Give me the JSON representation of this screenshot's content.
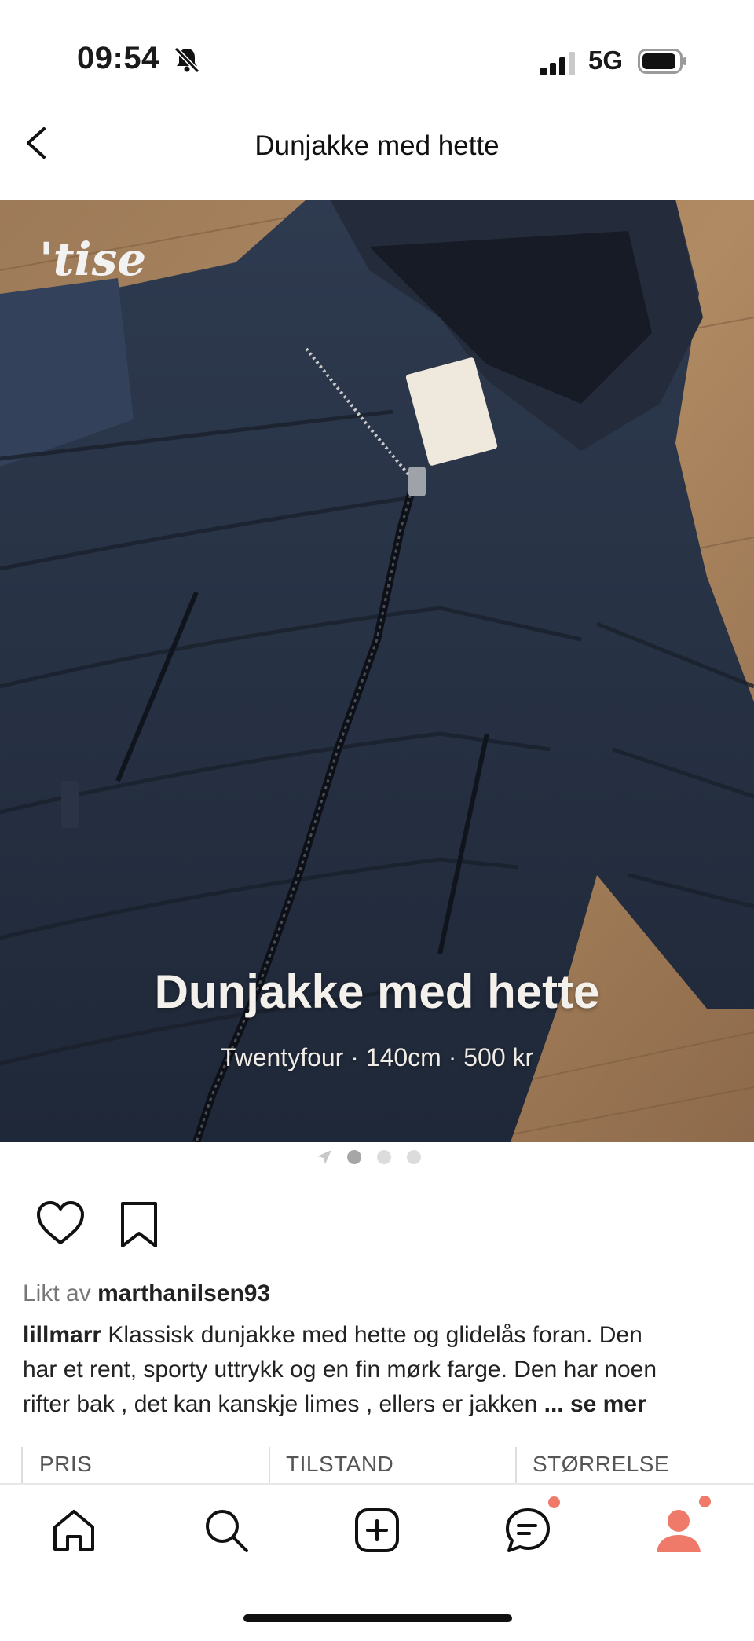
{
  "status_bar": {
    "time": "09:54",
    "network": "5G"
  },
  "header": {
    "title": "Dunjakke med hette"
  },
  "listing": {
    "overlay_title": "Dunjakke med hette",
    "overlay_subtitle": "Twentyfour · 140cm · 500 kr",
    "watermark": "'tise",
    "image_count": 3,
    "current_image": 1
  },
  "social": {
    "liked_prefix": "Likt av",
    "liked_user": "marthanilsen93",
    "seller": "lillmarr",
    "line1": "Klassisk dunjakke med hette og glidelås foran. Den",
    "line2": "har et rent, sporty uttrykk og en fin mørk farge. Den har noen",
    "line3": "rifter bak , det kan kanskje limes , ellers er jakken",
    "more": "... se mer"
  },
  "info_columns": [
    "PRIS",
    "TILSTAND",
    "STØRRELSE"
  ],
  "tabs": [
    {
      "icon": "home-icon"
    },
    {
      "icon": "search-icon"
    },
    {
      "icon": "add-listing-icon"
    },
    {
      "icon": "chat-icon",
      "badge": true
    },
    {
      "icon": "profile-icon",
      "badge": true
    }
  ],
  "colors": {
    "accent": "#ef7a6a",
    "text": "#1a1a1a",
    "muted": "#777777"
  }
}
